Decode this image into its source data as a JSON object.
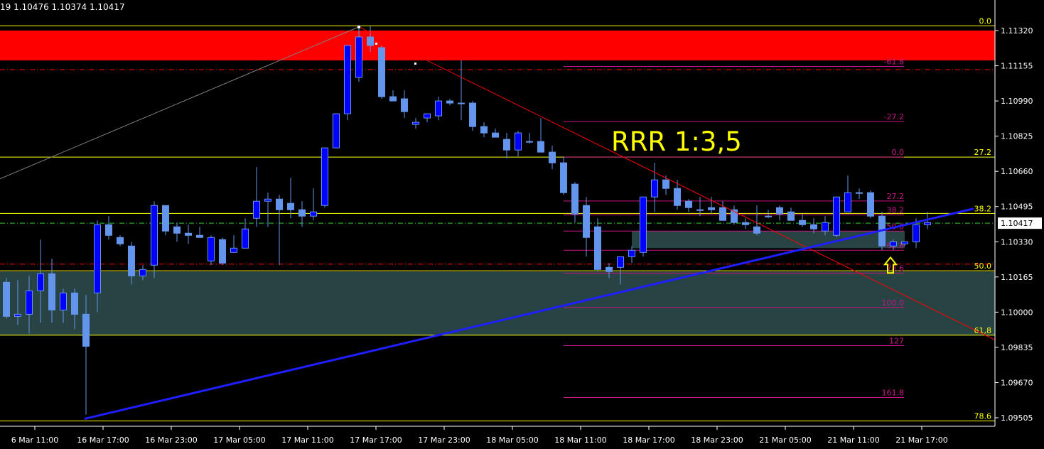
{
  "header": {
    "ohlc_text": "19 1.10476 1.10374 1.10417"
  },
  "colors": {
    "background": "#000000",
    "bull_body": "#0000FF",
    "bear_body": "#6495ED",
    "wick": "#6495ED",
    "trendline": "#1E1EFF",
    "resistance_zone": "#FF0000",
    "support_zone": "#2F4F4F",
    "fib_yellow": "#FFFF00",
    "fib_pink": "#C71585",
    "down_line": "#FF0000",
    "text": "#FFFFFF"
  },
  "chart_data": {
    "type": "candlestick",
    "ylim": [
      1.0946,
      1.1145
    ],
    "y_ticks": [
      1.1132,
      1.11155,
      1.1099,
      1.10825,
      1.1066,
      1.10495,
      1.1033,
      1.10165,
      1.1,
      1.09835,
      1.0967,
      1.09505
    ],
    "y_tick_labels": [
      "1.11320",
      "1.11155",
      "1.10990",
      "1.10825",
      "1.10660",
      "1.10495",
      "1.10330",
      "1.10165",
      "1.10000",
      "1.09835",
      "1.09670",
      "1.09505"
    ],
    "current_price": 1.10417,
    "current_price_label": "1.10417",
    "x_labels": [
      {
        "index": 0,
        "label": "6 Mar 11:00"
      },
      {
        "index": 6,
        "label": "16 Mar 17:00"
      },
      {
        "index": 12,
        "label": "16 Mar 23:00"
      },
      {
        "index": 18,
        "label": "17 Mar 05:00"
      },
      {
        "index": 24,
        "label": "17 Mar 11:00"
      },
      {
        "index": 30,
        "label": "17 Mar 17:00"
      },
      {
        "index": 36,
        "label": "17 Mar 23:00"
      },
      {
        "index": 42,
        "label": "18 Mar 05:00"
      },
      {
        "index": 48,
        "label": "18 Mar 11:00"
      },
      {
        "index": 54,
        "label": "18 Mar 17:00"
      },
      {
        "index": 60,
        "label": "18 Mar 23:00"
      },
      {
        "index": 66,
        "label": "21 Mar 05:00"
      },
      {
        "index": 72,
        "label": "21 Mar 11:00"
      },
      {
        "index": 78,
        "label": "21 Mar 17:00"
      }
    ],
    "candles": [
      [
        1.1014,
        1.1016,
        1.0997,
        1.0998
      ],
      [
        1.0998,
        1.1015,
        1.0994,
        1.0999
      ],
      [
        1.0999,
        1.1017,
        1.099,
        1.101
      ],
      [
        1.101,
        1.1034,
        1.0995,
        1.1018
      ],
      [
        1.1018,
        1.1025,
        1.0995,
        1.1001
      ],
      [
        1.1001,
        1.1011,
        1.0995,
        1.1009
      ],
      [
        1.1009,
        1.1011,
        1.0992,
        1.0999
      ],
      [
        1.0999,
        1.1008,
        1.0952,
        1.0984
      ],
      [
        1.1009,
        1.1043,
        1.1,
        1.1041
      ],
      [
        1.1041,
        1.1045,
        1.1034,
        1.1036
      ],
      [
        1.1035,
        1.1036,
        1.1031,
        1.1032
      ],
      [
        1.1031,
        1.1033,
        1.1013,
        1.1017
      ],
      [
        1.1017,
        1.1022,
        1.1015,
        1.102
      ],
      [
        1.1022,
        1.1052,
        1.1016,
        1.105
      ],
      [
        1.105,
        1.105,
        1.1036,
        1.1038
      ],
      [
        1.104,
        1.1042,
        1.1033,
        1.1037
      ],
      [
        1.1037,
        1.1041,
        1.1032,
        1.1036
      ],
      [
        1.1036,
        1.104,
        1.1035,
        1.1035
      ],
      [
        1.1024,
        1.1036,
        1.1022,
        1.1035
      ],
      [
        1.1034,
        1.1035,
        1.1022,
        1.1023
      ],
      [
        1.1028,
        1.1036,
        1.1028,
        1.103
      ],
      [
        1.103,
        1.1044,
        1.103,
        1.1039
      ],
      [
        1.1044,
        1.1068,
        1.104,
        1.1052
      ],
      [
        1.1052,
        1.1056,
        1.104,
        1.1053
      ],
      [
        1.1053,
        1.1055,
        1.1022,
        1.1048
      ],
      [
        1.1051,
        1.1063,
        1.1044,
        1.1048
      ],
      [
        1.1048,
        1.1052,
        1.104,
        1.1045
      ],
      [
        1.1045,
        1.1058,
        1.1043,
        1.1047
      ],
      [
        1.105,
        1.1076,
        1.1049,
        1.1077
      ],
      [
        1.1077,
        1.1084,
        1.1077,
        1.1093
      ],
      [
        1.1093,
        1.1118,
        1.109,
        1.1125
      ],
      [
        1.111,
        1.1134,
        1.1108,
        1.1129
      ],
      [
        1.1129,
        1.1134,
        1.1122,
        1.1125
      ],
      [
        1.1124,
        1.1125,
        1.11,
        1.1101
      ],
      [
        1.1101,
        1.1104,
        1.1099,
        1.1099
      ],
      [
        1.11,
        1.1104,
        1.1091,
        1.1094
      ],
      [
        1.1088,
        1.1091,
        1.1086,
        1.1089
      ],
      [
        1.1091,
        1.1093,
        1.1089,
        1.1093
      ],
      [
        1.1092,
        1.1101,
        1.109,
        1.1099
      ],
      [
        1.1099,
        1.11,
        1.1097,
        1.1098
      ],
      [
        1.1098,
        1.1118,
        1.109,
        1.1098
      ],
      [
        1.1098,
        1.1099,
        1.1085,
        1.1087
      ],
      [
        1.1087,
        1.1089,
        1.1082,
        1.1084
      ],
      [
        1.1084,
        1.1086,
        1.1082,
        1.1082
      ],
      [
        1.1081,
        1.1084,
        1.1072,
        1.1076
      ],
      [
        1.1076,
        1.1085,
        1.1073,
        1.1084
      ],
      [
        1.108,
        1.1084,
        1.1079,
        1.108
      ],
      [
        1.108,
        1.1091,
        1.1075,
        1.1075
      ],
      [
        1.1075,
        1.1078,
        1.1067,
        1.107
      ],
      [
        1.107,
        1.1073,
        1.1055,
        1.1056
      ],
      [
        1.106,
        1.1061,
        1.1042,
        1.1046
      ],
      [
        1.105,
        1.1054,
        1.1026,
        1.1035
      ],
      [
        1.104,
        1.1044,
        1.1019,
        1.102
      ],
      [
        1.1021,
        1.1023,
        1.1016,
        1.1019
      ],
      [
        1.1021,
        1.1023,
        1.1013,
        1.1026
      ],
      [
        1.1026,
        1.1031,
        1.1023,
        1.1029
      ],
      [
        1.1028,
        1.1041,
        1.1026,
        1.1054
      ],
      [
        1.1054,
        1.107,
        1.1047,
        1.1062
      ],
      [
        1.1062,
        1.1064,
        1.1055,
        1.1058
      ],
      [
        1.1058,
        1.1062,
        1.1048,
        1.105
      ],
      [
        1.1052,
        1.1053,
        1.1047,
        1.1049
      ],
      [
        1.1048,
        1.1054,
        1.1045,
        1.1048
      ],
      [
        1.1049,
        1.1054,
        1.1046,
        1.1048
      ],
      [
        1.1049,
        1.1052,
        1.1043,
        1.1043
      ],
      [
        1.1048,
        1.105,
        1.1041,
        1.1042
      ],
      [
        1.1042,
        1.1044,
        1.1039,
        1.1041
      ],
      [
        1.104,
        1.105,
        1.1036,
        1.1037
      ],
      [
        1.1045,
        1.1048,
        1.1044,
        1.1045
      ],
      [
        1.1049,
        1.105,
        1.1043,
        1.1046
      ],
      [
        1.1047,
        1.1049,
        1.1043,
        1.1043
      ],
      [
        1.1043,
        1.1046,
        1.104,
        1.1041
      ],
      [
        1.1041,
        1.1044,
        1.1037,
        1.1039
      ],
      [
        1.1038,
        1.1045,
        1.1036,
        1.1042
      ],
      [
        1.1036,
        1.1046,
        1.1035,
        1.1054
      ],
      [
        1.1047,
        1.1064,
        1.1048,
        1.1056
      ],
      [
        1.1056,
        1.1058,
        1.1053,
        1.1056
      ],
      [
        1.1056,
        1.1057,
        1.1044,
        1.1045
      ],
      [
        1.1045,
        1.1047,
        1.1029,
        1.1031
      ],
      [
        1.1031,
        1.1034,
        1.1029,
        1.1033
      ],
      [
        1.1032,
        1.1033,
        1.1031,
        1.1033
      ],
      [
        1.1033,
        1.1044,
        1.103,
        1.1041
      ],
      [
        1.1041,
        1.1047,
        1.1039,
        1.1042
      ]
    ],
    "zones": [
      {
        "id": "resistance",
        "y_top": 1.1132,
        "y_bottom": 1.1118,
        "x_from_index": -1,
        "x_to_index": 118,
        "color": "#FF0000"
      },
      {
        "id": "support-main",
        "y_top": 1.1019,
        "y_bottom": 1.0989,
        "x_from_index": -1,
        "x_to_index": 118,
        "color": "#2F4F4F"
      },
      {
        "id": "support-entry",
        "y_top": 1.1038,
        "y_bottom": 1.103,
        "x_from_index": 55,
        "x_to_index": 79,
        "color": "#2F4F4F"
      }
    ],
    "fib_levels_yellow": [
      {
        "price": 1.11342,
        "label": "0.0"
      },
      {
        "price": 1.10727,
        "label": "27.2"
      },
      {
        "price": 1.10463,
        "label": "38.2"
      },
      {
        "price": 1.10194,
        "label": "50.0"
      },
      {
        "price": 1.09892,
        "label": "61,8"
      },
      {
        "price": 1.0949,
        "label": "78.6"
      }
    ],
    "fib_levels_pink": [
      {
        "price": 1.11152,
        "label": "-61.8"
      },
      {
        "price": 1.10893,
        "label": "-27.2"
      },
      {
        "price": 1.10727,
        "label": "0.0"
      },
      {
        "price": 1.10521,
        "label": "27.2"
      },
      {
        "price": 1.10456,
        "label": "38.2"
      },
      {
        "price": 1.1038,
        "label": "50.0"
      },
      {
        "price": 1.1029,
        "label": "61.8"
      },
      {
        "price": 1.10183,
        "label": "78.6"
      },
      {
        "price": 1.10022,
        "label": "100.0"
      },
      {
        "price": 1.09843,
        "label": "127"
      },
      {
        "price": 1.096,
        "label": "161.8"
      }
    ],
    "dashed_lines": [
      {
        "price": 1.11137,
        "color": "#FF0000"
      },
      {
        "price": 1.10417,
        "color": "#32CD32"
      },
      {
        "price": 1.10225,
        "color": "#FF0000"
      }
    ],
    "trendline_up": {
      "from_index": 7,
      "from_price": 1.095,
      "to_index": 116,
      "to_price": 1.10485
    },
    "down_line": {
      "from_index": 31,
      "from_price": 1.11337,
      "to_index": 118,
      "to_price": 1.0987
    },
    "thin_line": {
      "from_index": -1,
      "from_price": 1.10625,
      "to_index": 31,
      "to_price": 1.11337
    },
    "annotation": "RRR 1:3,5",
    "arrow_index": 78,
    "arrow_price": 1.1023
  }
}
